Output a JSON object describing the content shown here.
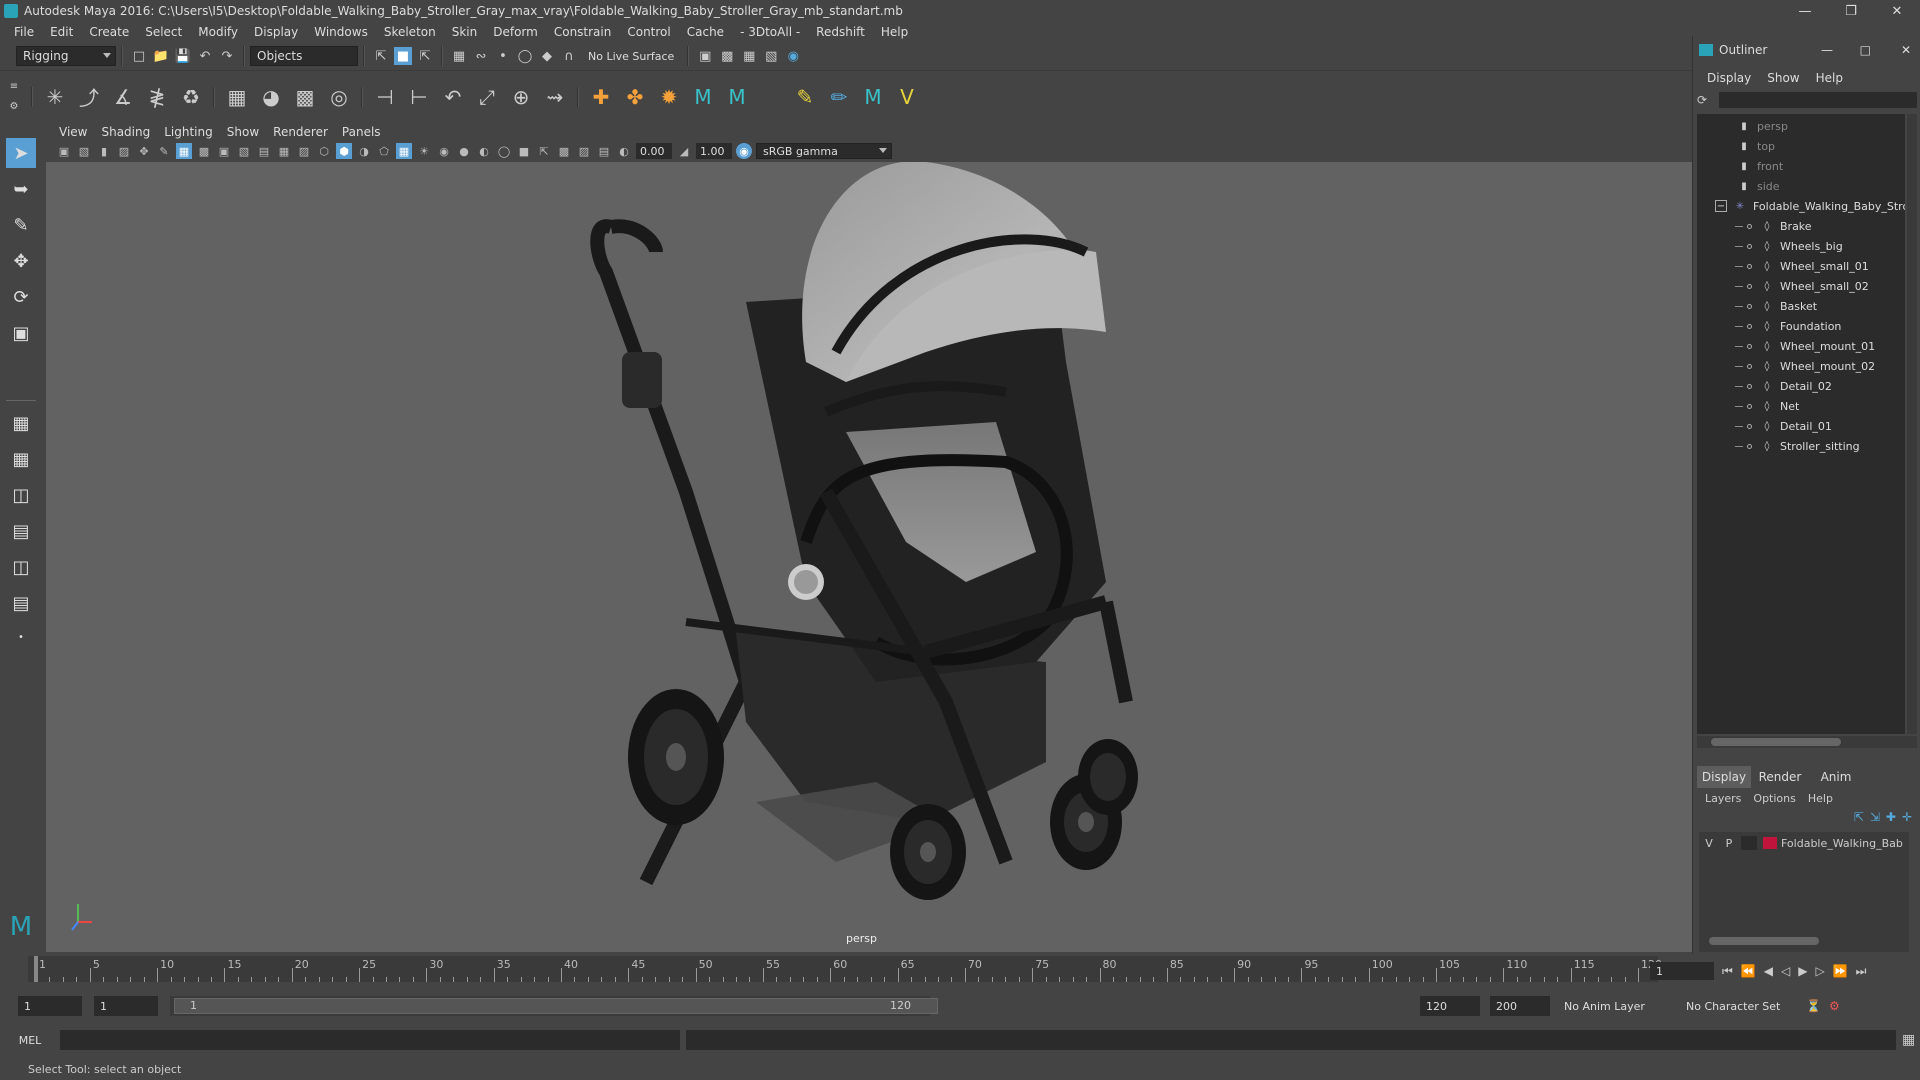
{
  "window": {
    "title": "Autodesk Maya 2016: C:\\Users\\I5\\Desktop\\Foldable_Walking_Baby_Stroller_Gray_max_vray\\Foldable_Walking_Baby_Stroller_Gray_mb_standart.mb"
  },
  "menubar": {
    "items": [
      "File",
      "Edit",
      "Create",
      "Select",
      "Modify",
      "Display",
      "Windows",
      "Skeleton",
      "Skin",
      "Deform",
      "Constrain",
      "Control",
      "Cache",
      "- 3DtoAll -",
      "Redshift",
      "Help"
    ]
  },
  "statusline": {
    "menuset": "Rigging",
    "selection_mode": "Objects",
    "live_surface": "No Live Surface"
  },
  "viewport": {
    "menus": [
      "View",
      "Shading",
      "Lighting",
      "Show",
      "Renderer",
      "Panels"
    ],
    "exposure": "0.00",
    "gamma": "1.00",
    "color_space": "sRGB gamma",
    "camera_label": "persp"
  },
  "outliner": {
    "title": "Outliner",
    "menus": [
      "Display",
      "Show",
      "Help"
    ],
    "cameras": [
      "persp",
      "top",
      "front",
      "side"
    ],
    "root": "Foldable_Walking_Baby_Stro",
    "children": [
      "Brake",
      "Wheels_big",
      "Wheel_small_01",
      "Wheel_small_02",
      "Basket",
      "Foundation",
      "Wheel_mount_01",
      "Wheel_mount_02",
      "Detail_02",
      "Net",
      "Detail_01",
      "Stroller_sitting"
    ]
  },
  "layer_editor": {
    "tabs": [
      "Display",
      "Render",
      "Anim"
    ],
    "menus": [
      "Layers",
      "Options",
      "Help"
    ],
    "layer": {
      "v": "V",
      "p": "P",
      "name": "Foldable_Walking_Bab",
      "color": "#c0143c"
    }
  },
  "timeline": {
    "ticks": [
      "1",
      "5",
      "10",
      "15",
      "20",
      "25",
      "30",
      "35",
      "40",
      "45",
      "50",
      "55",
      "60",
      "65",
      "70",
      "75",
      "80",
      "85",
      "90",
      "95",
      "100",
      "105",
      "110",
      "115",
      "120"
    ],
    "current_frame": "1"
  },
  "range": {
    "start": "1",
    "playback_start": "1",
    "slider_start": "1",
    "slider_end": "120",
    "playback_end": "120",
    "end": "200",
    "anim_layer": "No Anim Layer",
    "character_set": "No Character Set"
  },
  "cmdline": {
    "label": "MEL"
  },
  "helpline": {
    "text": "Select Tool: select an object"
  },
  "colors": {
    "accent": "#5a9fd4",
    "maya_teal": "#2aa3b8"
  }
}
